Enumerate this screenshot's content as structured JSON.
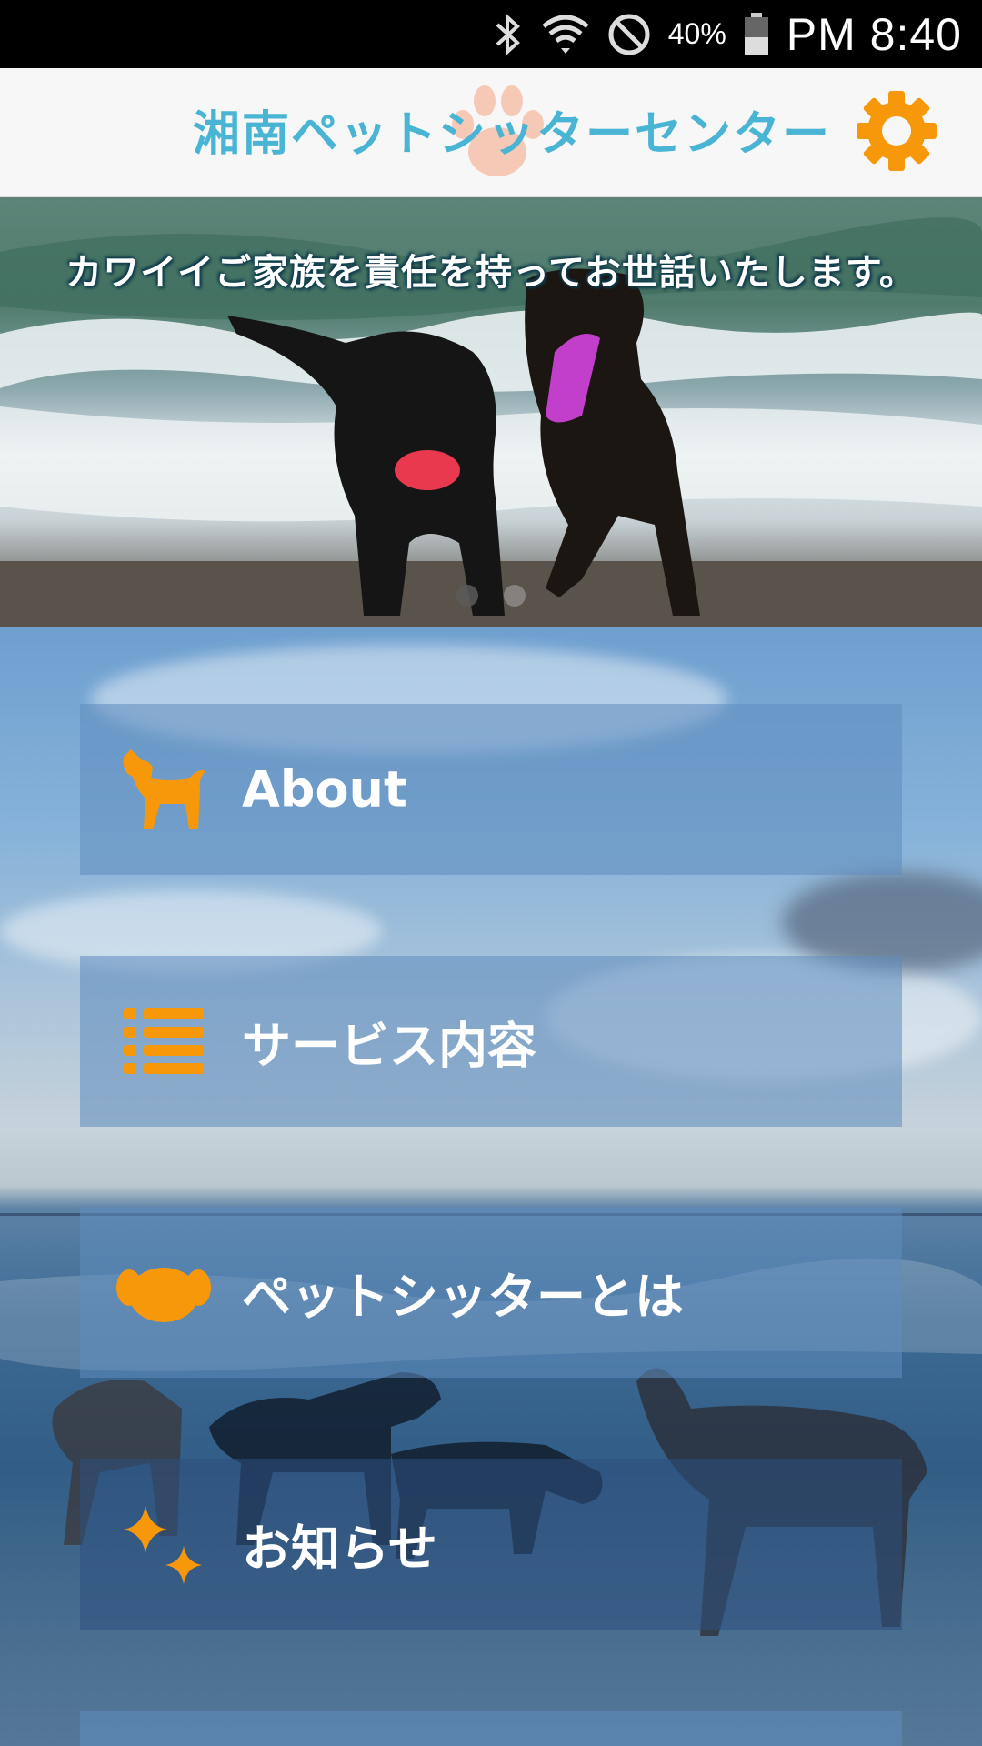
{
  "status_bar": {
    "battery_percent": "40%",
    "time": "PM 8:40",
    "icons": [
      "bluetooth-icon",
      "wifi-icon",
      "do-not-disturb-icon",
      "battery-icon"
    ]
  },
  "header": {
    "title": "湘南ペットシッターセンター",
    "settings_icon": "gear-icon",
    "accent_color": "#f7980b",
    "title_color": "#49b4d3"
  },
  "hero": {
    "caption": "カワイイご家族を責任を持ってお世話いたします。",
    "slide_count": 2,
    "active_slide": 1
  },
  "menu": {
    "items": [
      {
        "label": "About",
        "icon": "dog-icon"
      },
      {
        "label": "サービス内容",
        "icon": "list-icon"
      },
      {
        "label": "ペットシッターとは",
        "icon": "dog-face-icon"
      },
      {
        "label": "お知らせ",
        "icon": "sparkle-icon"
      }
    ]
  }
}
